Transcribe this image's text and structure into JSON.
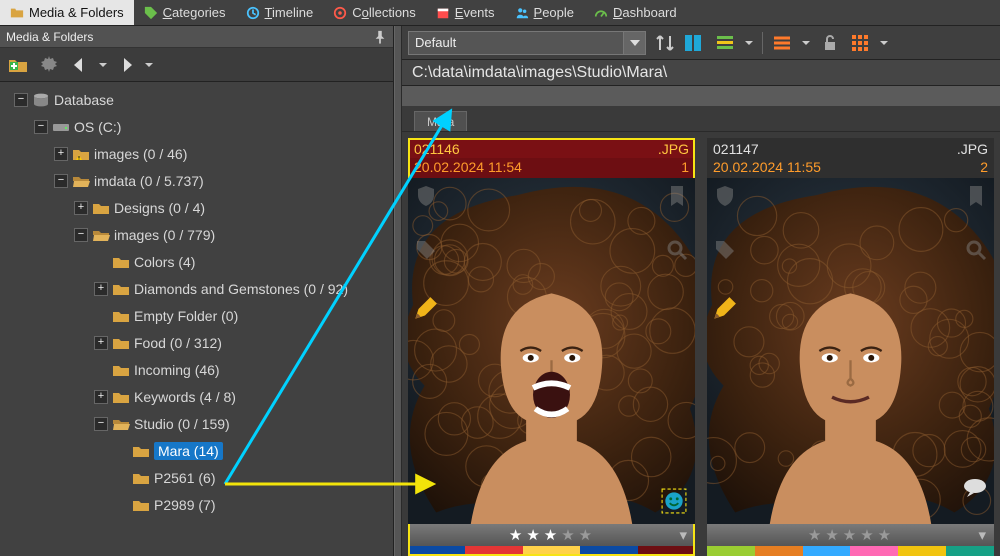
{
  "tabs": [
    {
      "label": "Media & Folders",
      "icon": "folder",
      "active": true
    },
    {
      "label": "Categories",
      "icon": "tag",
      "u": 0
    },
    {
      "label": "Timeline",
      "icon": "clock",
      "u": 0
    },
    {
      "label": "Collections",
      "icon": "disc",
      "u": 1
    },
    {
      "label": "Events",
      "icon": "calendar",
      "u": 0
    },
    {
      "label": "People",
      "icon": "people",
      "u": 0
    },
    {
      "label": "Dashboard",
      "icon": "gauge",
      "u": 0
    }
  ],
  "panel_title": "Media & Folders",
  "combo_value": "Default",
  "path": "C:\\data\\imdata\\images\\Studio\\Mara\\",
  "breadcrumb": "Mara",
  "tree": [
    {
      "depth": 0,
      "toggle": "-",
      "icon": "db",
      "label": "Database"
    },
    {
      "depth": 1,
      "toggle": "-",
      "icon": "drive",
      "label": "OS (C:)"
    },
    {
      "depth": 2,
      "toggle": "+",
      "icon": "folder-warn",
      "label": "images (0 / 46)",
      "warn": true
    },
    {
      "depth": 2,
      "toggle": "-",
      "icon": "folder-open",
      "label": "imdata (0 / 5.737)"
    },
    {
      "depth": 3,
      "toggle": "+",
      "icon": "folder",
      "label": "Designs (0 / 4)"
    },
    {
      "depth": 3,
      "toggle": "-",
      "icon": "folder-open",
      "label": "images (0 / 779)"
    },
    {
      "depth": 4,
      "toggle": "",
      "icon": "folder",
      "label": "Colors (4)"
    },
    {
      "depth": 4,
      "toggle": "+",
      "icon": "folder",
      "label": "Diamonds and Gemstones (0 / 92)"
    },
    {
      "depth": 4,
      "toggle": "",
      "icon": "folder",
      "label": "Empty Folder (0)"
    },
    {
      "depth": 4,
      "toggle": "+",
      "icon": "folder",
      "label": "Food (0 / 312)"
    },
    {
      "depth": 4,
      "toggle": "",
      "icon": "folder",
      "label": "Incoming (46)"
    },
    {
      "depth": 4,
      "toggle": "+",
      "icon": "folder",
      "label": "Keywords (4 / 8)"
    },
    {
      "depth": 4,
      "toggle": "-",
      "icon": "folder-open",
      "label": "Studio (0 / 159)"
    },
    {
      "depth": 5,
      "toggle": "",
      "icon": "folder",
      "label": "Mara (14)",
      "selected": true
    },
    {
      "depth": 5,
      "toggle": "",
      "icon": "folder",
      "label": "P2561 (6)"
    },
    {
      "depth": 5,
      "toggle": "",
      "icon": "folder",
      "label": "P2989 (7)"
    }
  ],
  "cards": [
    {
      "name": "021146",
      "ext": ".JPG",
      "date": "20.02.2024 11:54",
      "idx": "1",
      "rating": 3,
      "selected": true,
      "colors": [
        "#0b4aa3",
        "#e33535",
        "#ffd24a",
        "#0b4aa3",
        "#6d0e12"
      ],
      "face": "open"
    },
    {
      "name": "021147",
      "ext": ".JPG",
      "date": "20.02.2024 11:55",
      "idx": "2",
      "rating": 0,
      "selected": false,
      "colors": [
        "#9acd32",
        "#e67e22",
        "#33aaff",
        "#ff69b4",
        "#f1c40f",
        "#16a085"
      ],
      "face": "calm"
    }
  ],
  "annotation": {
    "color_up": "#00d1ff",
    "color_right": "#f2e40a"
  }
}
